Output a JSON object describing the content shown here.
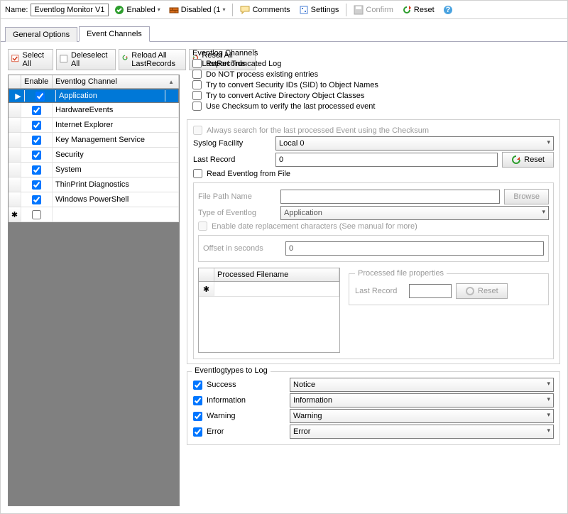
{
  "toolbar": {
    "name_label": "Name:",
    "name_value": "Eventlog Monitor V1",
    "enabled": "Enabled",
    "disabled": "Disabled (1",
    "comments": "Comments",
    "settings": "Settings",
    "confirm": "Confirm",
    "reset": "Reset"
  },
  "tabs": {
    "general": "General Options",
    "channels": "Event Channels"
  },
  "actions": {
    "select_all": "Select All",
    "deselect_all": "Deleselect All",
    "reload": "Reload All LastRecords",
    "reset_all": "Reset All LastRecords"
  },
  "grid": {
    "hdr_enable": "Enable",
    "hdr_channel": "Eventlog Channel",
    "rows": [
      {
        "enable": true,
        "name": "Application"
      },
      {
        "enable": true,
        "name": "HardwareEvents"
      },
      {
        "enable": true,
        "name": "Internet Explorer"
      },
      {
        "enable": true,
        "name": "Key Management Service"
      },
      {
        "enable": true,
        "name": "Security"
      },
      {
        "enable": true,
        "name": "System"
      },
      {
        "enable": true,
        "name": "ThinPrint Diagnostics"
      },
      {
        "enable": true,
        "name": "Windows PowerShell"
      }
    ]
  },
  "opts": {
    "legend": "Eventlog Channels",
    "truncated": "Report Truncated Log",
    "noprocess": "Do NOT process existing entries",
    "sid": "Try to convert Security IDs (SID) to Object Names",
    "adoc": "Try to convert Active Directory Object Classes",
    "checksum": "Use Checksum to verify the last processed event",
    "always": "Always search for the last processed Event using the Checksum",
    "facility_label": "Syslog Facility",
    "facility_value": "Local 0",
    "lastrec_label": "Last Record",
    "lastrec_value": "0",
    "reset_btn": "Reset",
    "readfile": "Read Eventlog from File",
    "filepath_label": "File  Path Name",
    "browse": "Browse",
    "type_label": "Type of Eventlog",
    "type_value": "Application",
    "enable_date": "Enable date replacement characters (See manual for more)",
    "offset_label": "Offset in seconds",
    "offset_value": "0",
    "processed_hdr": "Processed Filename",
    "props_legend": "Processed file properties",
    "props_last": "Last Record",
    "props_reset": "Reset"
  },
  "logtypes": {
    "legend": "Eventlogtypes to Log",
    "rows": [
      {
        "label": "Success",
        "value": "Notice"
      },
      {
        "label": "Information",
        "value": "Information"
      },
      {
        "label": "Warning",
        "value": "Warning"
      },
      {
        "label": "Error",
        "value": "Error"
      }
    ]
  }
}
